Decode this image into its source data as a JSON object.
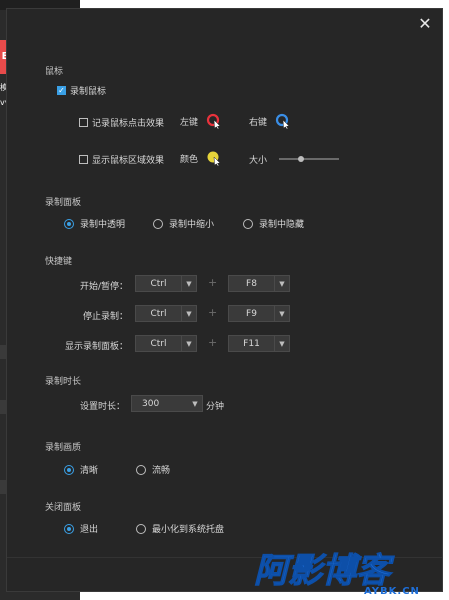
{
  "background_app": {
    "badge_text": "E",
    "fragments": [
      "模",
      "vv"
    ]
  },
  "dialog": {
    "close_icon": "close-icon"
  },
  "mouse": {
    "title": "鼠标",
    "record_cursor_label": "录制鼠标",
    "record_click_effect_label": "记录鼠标点击效果",
    "left_key_label": "左键",
    "right_key_label": "右键",
    "show_area_effect_label": "显示鼠标区域效果",
    "color_label": "颜色",
    "size_label": "大小",
    "size_level": 0.35,
    "colors": {
      "left_click": "#e8323c",
      "right_click": "#3a8ee6",
      "area": "#e6d43a"
    }
  },
  "record_panel": {
    "title": "录制面板",
    "options": [
      "录制中透明",
      "录制中缩小",
      "录制中隐藏"
    ],
    "selected": 0
  },
  "hotkeys": {
    "title": "快捷键",
    "plus": "+",
    "rows": [
      {
        "label": "开始/暂停：",
        "modifier": "Ctrl",
        "key": "F8"
      },
      {
        "label": "停止录制：",
        "modifier": "Ctrl",
        "key": "F9"
      },
      {
        "label": "显示录制面板：",
        "modifier": "Ctrl",
        "key": "F11"
      }
    ]
  },
  "duration": {
    "title": "录制时长",
    "label": "设置时长：",
    "value": "300",
    "unit": "分钟"
  },
  "quality": {
    "title": "录制画质",
    "options": [
      "清晰",
      "流畅"
    ],
    "selected": 0
  },
  "close_panel": {
    "title": "关闭面板",
    "options": [
      "退出",
      "最小化到系统托盘"
    ],
    "selected": 0
  },
  "watermark": {
    "main": "阿影博客",
    "sub": "AYBK.CN"
  }
}
